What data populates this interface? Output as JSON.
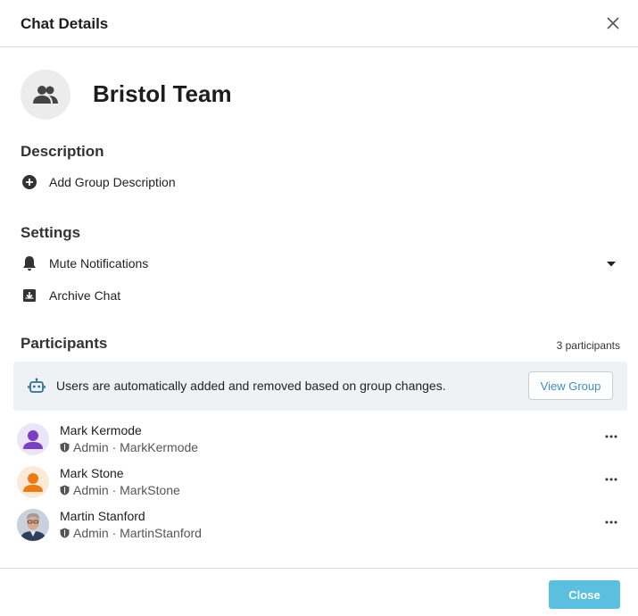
{
  "header": {
    "title": "Chat Details",
    "close_icon": "close-icon"
  },
  "group": {
    "name": "Bristol Team",
    "avatar_icon": "group-icon"
  },
  "description": {
    "title": "Description",
    "add_label": "Add Group Description",
    "add_icon": "plus-circle-icon"
  },
  "settings": {
    "title": "Settings",
    "mute_label": "Mute Notifications",
    "mute_icon": "bell-icon",
    "archive_label": "Archive Chat",
    "archive_icon": "archive-icon"
  },
  "participants": {
    "title": "Participants",
    "count_label": "3 participants",
    "banner_text": "Users are automatically added and removed based on group changes.",
    "banner_icon": "robot-icon",
    "view_group_label": "View Group",
    "list": [
      {
        "name": "Mark Kermode",
        "role": "Admin",
        "username": "MarkKermode",
        "avatar_color": "#7b3fc4",
        "avatar_bg": "#ece4f7"
      },
      {
        "name": "Mark Stone",
        "role": "Admin",
        "username": "MarkStone",
        "avatar_color": "#f07a12",
        "avatar_bg": "#fde9d7"
      },
      {
        "name": "Martin Stanford",
        "role": "Admin",
        "username": "MartinStanford",
        "avatar_color": "#8a6a5a",
        "avatar_bg": "#c9d2dc"
      }
    ]
  },
  "footer": {
    "close_label": "Close"
  },
  "colors": {
    "accent": "#5bc0e0",
    "link": "#3a8fc9",
    "banner_bg": "#eef2f4"
  }
}
